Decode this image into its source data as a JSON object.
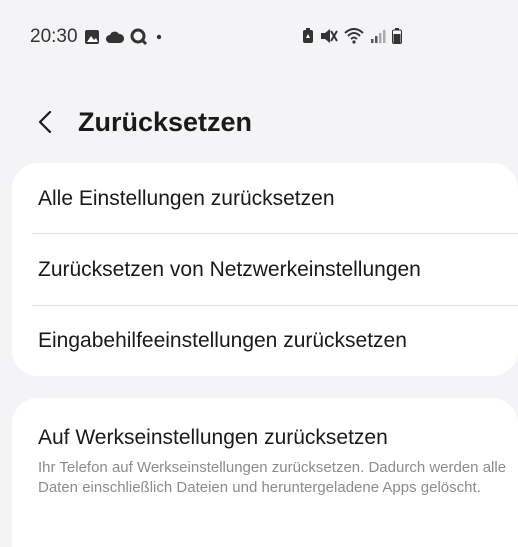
{
  "status_bar": {
    "time": "20:30",
    "left_icons": [
      "image-icon",
      "cloud-icon",
      "search-app-icon",
      "dot-icon"
    ],
    "right_icons": [
      "battery-saver-icon",
      "mute-icon",
      "wifi-icon",
      "signal-icon",
      "battery-icon"
    ]
  },
  "header": {
    "back_icon": "chevron-left-icon",
    "title": "Zurücksetzen"
  },
  "reset_options": {
    "items": [
      {
        "label": "Alle Einstellungen zurücksetzen"
      },
      {
        "label": "Zurücksetzen von Netzwerkeinstellungen"
      },
      {
        "label": "Eingabehilfeeinstellungen zurücksetzen"
      }
    ]
  },
  "factory_reset": {
    "label": "Auf Werkseinstellungen zurücksetzen",
    "description": "Ihr Telefon auf Werkseinstellungen zurücksetzen. Dadurch werden alle Daten einschließlich Dateien und heruntergeladene Apps gelöscht."
  }
}
